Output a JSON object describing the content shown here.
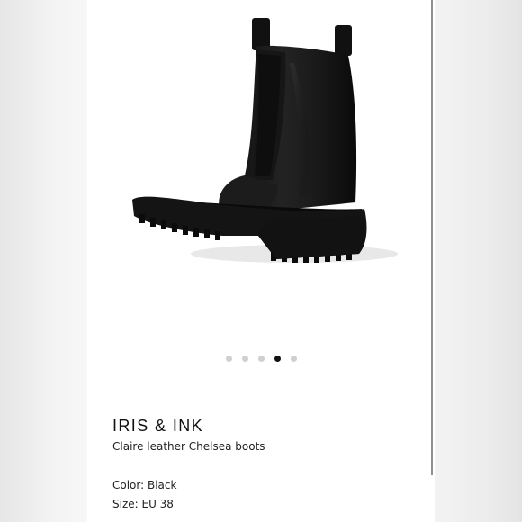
{
  "product": {
    "brand": "IRIS & INK",
    "name": "Claire leather Chelsea boots",
    "color_text": "Color: Black",
    "size_text": "Size: EU 38",
    "image_subject": "black leather chelsea boot with chunky lug sole"
  },
  "carousel": {
    "total": 5,
    "active_index": 4
  },
  "colors": {
    "accent_dot_active": "#111111",
    "dot_inactive": "#cfcfcf",
    "boot": "#1a1a1a"
  }
}
